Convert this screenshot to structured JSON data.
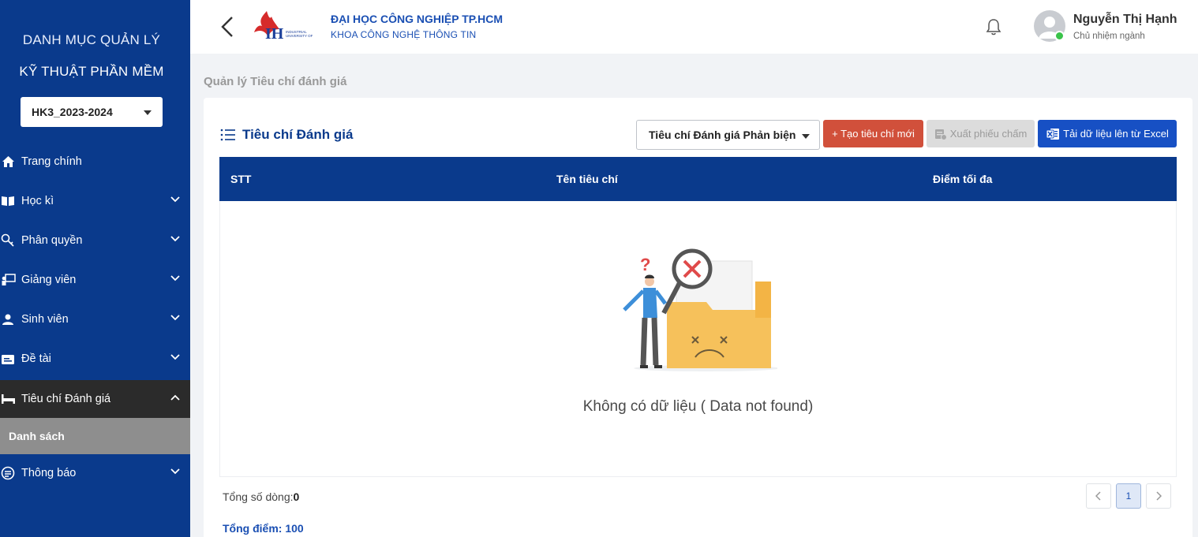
{
  "sidebar": {
    "title_line1": "DANH MỤC QUẢN LÝ",
    "title_line2": "KỸ THUẬT PHẦN MỀM",
    "semester": "HK3_2023-2024",
    "items": [
      {
        "label": "Trang chính",
        "icon": "home-icon"
      },
      {
        "label": "Học kì",
        "icon": "book-icon"
      },
      {
        "label": "Phân quyền",
        "icon": "key-icon"
      },
      {
        "label": "Giảng viên",
        "icon": "teacher-icon"
      },
      {
        "label": "Sinh viên",
        "icon": "student-icon"
      },
      {
        "label": "Đề tài",
        "icon": "topic-icon"
      },
      {
        "label": "Tiêu chí Đánh giá",
        "icon": "bed-icon"
      },
      {
        "label": "Thông báo",
        "icon": "message-icon"
      }
    ],
    "sub_item": "Danh sách"
  },
  "header": {
    "brand_line1": "ĐẠI HỌC CÔNG NGHIỆP TP.HCM",
    "brand_line2": "KHOA CÔNG NGHỆ THÔNG TIN",
    "user_name": "Nguyễn Thị Hạnh",
    "user_role": "Chủ nhiệm ngành"
  },
  "breadcrumb": "Quản lý Tiêu chí đánh giá",
  "card": {
    "title": "Tiêu chí Đánh giá",
    "type_select": "Tiêu chí Đánh giá Phản biện",
    "create_label": "+ Tạo tiêu chí mới",
    "export_label": "Xuất phiếu chấm",
    "upload_label": "Tải dữ liệu lên từ Excel"
  },
  "table": {
    "columns": [
      "STT",
      "Tên tiêu chí",
      "Điểm tối đa"
    ],
    "empty_text": "Không có dữ liệu ( Data not found)"
  },
  "footer": {
    "total_rows_label": "Tổng số dòng:",
    "total_rows_value": "0",
    "current_page": "1",
    "total_score": "Tổng điểm: 100"
  },
  "colors": {
    "sidebar": "#0a3a8c",
    "create": "#d1503b",
    "upload": "#1750c4",
    "active": "#2b2b2b"
  }
}
